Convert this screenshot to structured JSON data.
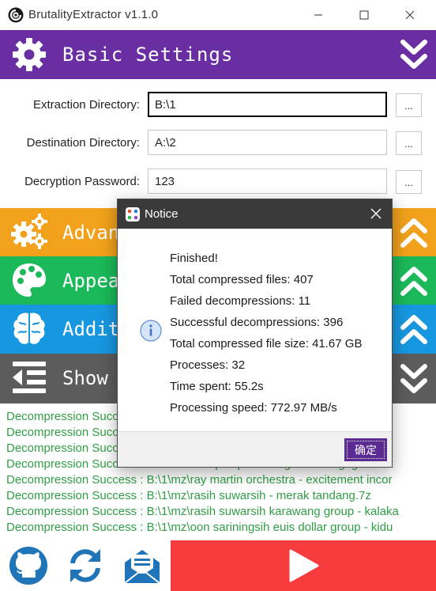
{
  "window": {
    "title": "BrutalityExtractor v1.1.0"
  },
  "sections": {
    "basic": {
      "title": "Basic Settings",
      "color": "#6a2ea3",
      "icon": "gear-icon"
    },
    "advanced": {
      "title": "Advan",
      "color": "#f1a11b",
      "icon": "gears-icon"
    },
    "appearance": {
      "title": "Appea",
      "color": "#1bb95a",
      "icon": "palette-icon"
    },
    "additional": {
      "title": "Addit",
      "color": "#1797e0",
      "icon": "brain-icon"
    },
    "show": {
      "title": "Show",
      "color": "#5c5c5c",
      "icon": "outdent-icon"
    }
  },
  "form": {
    "extraction": {
      "label": "Extraction Directory:",
      "value": "B:\\1",
      "browse": "..."
    },
    "destination": {
      "label": "Destination Directory:",
      "value": "A:\\2",
      "browse": "..."
    },
    "password": {
      "label": "Decryption Password:",
      "value": "123",
      "browse": "..."
    }
  },
  "log": {
    "lines": [
      "Decompression Success : B:\\1\\mz\\acil kilmas - the right place to be - aw",
      "Decompression Success : B:\\1\\mz\\acang rusdiyana - kidung sunda - kidu",
      "Decompression Success : B:\\1\\mz\\acang rusdiyana - kidung sunda - kidu",
      "Decompression Success : B:\\1\\mz\\cecep suprianto - gatalkaca gagat 3.7z",
      "Decompression Success : B:\\1\\mz\\ray martin orchestra - excitement incor",
      "Decompression Success : B:\\1\\mz\\rasih suwarsih - merak tandang.7z",
      "Decompression Success : B:\\1\\mz\\rasih suwarsih karawang group - kalaka",
      "Decompression Success : B:\\1\\mz\\oon sariningsih euis dollar group - kidu"
    ],
    "color": "#2f9e45"
  },
  "bottom_bar": {
    "github": "github-icon",
    "sync": "sync-icon",
    "mail": "mail-icon",
    "start": "play-icon",
    "start_color": "#f53b3b"
  },
  "dialog": {
    "title": "Notice",
    "lines": [
      "Finished!",
      "Total compressed files: 407",
      "Failed decompressions: 11",
      "Successful decompressions: 396",
      "Total compressed file size: 41.67 GB",
      "Processes: 32",
      "Time spent: 55.2s",
      "Processing speed: 772.97 MB/s"
    ],
    "ok_label": "确定"
  }
}
